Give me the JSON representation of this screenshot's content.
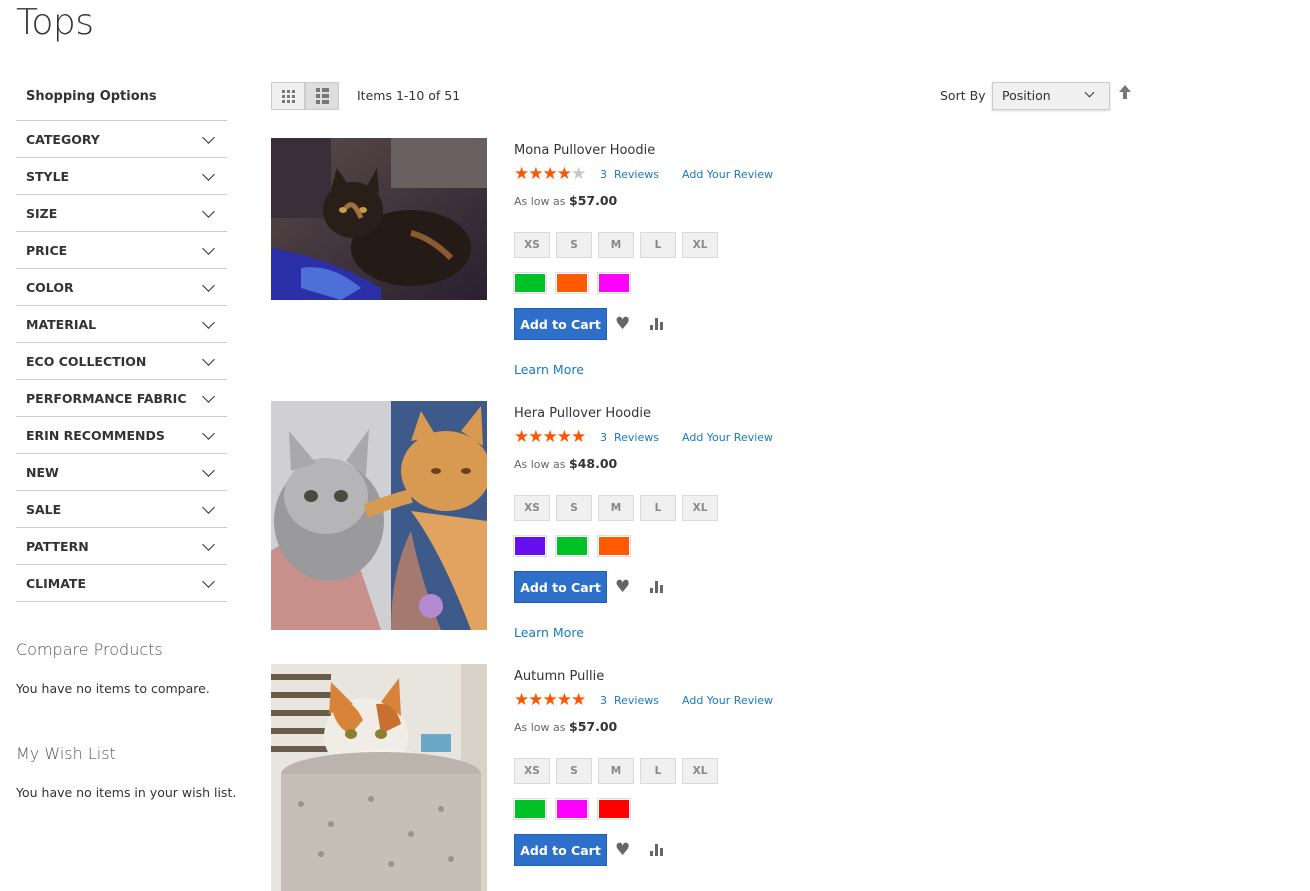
{
  "page": {
    "title": "Tops"
  },
  "sidebar": {
    "title": "Shopping Options",
    "filters": [
      "CATEGORY",
      "STYLE",
      "SIZE",
      "PRICE",
      "COLOR",
      "MATERIAL",
      "ECO COLLECTION",
      "PERFORMANCE FABRIC",
      "ERIN RECOMMENDS",
      "NEW",
      "SALE",
      "PATTERN",
      "CLIMATE"
    ],
    "compare": {
      "title": "Compare Products",
      "empty": "You have no items to compare."
    },
    "wishlist": {
      "title": "My Wish List",
      "empty": "You have no items in your wish list."
    }
  },
  "toolbar": {
    "view_modes": [
      "grid-icon",
      "list-icon"
    ],
    "active_mode": "list",
    "amount": "Items 1-10 of 51",
    "sort_label": "Sort By",
    "sort_value": "Position",
    "sort_direction_icon": "arrow-up-icon"
  },
  "colors": {
    "link": "#1979c3",
    "button": "#2e6fca",
    "star": "#ff5501",
    "star_off": "#c6c6c6"
  },
  "products": [
    {
      "name": "Mona Pullover Hoodie",
      "rating_stars": 4,
      "reviews_count": "3",
      "reviews_label": "Reviews",
      "add_review": "Add Your Review",
      "price_prefix": "As low as",
      "price": "$57.00",
      "sizes": [
        "XS",
        "S",
        "M",
        "L",
        "XL"
      ],
      "swatches": [
        "#00c226",
        "#ff5a00",
        "#ff00ff"
      ],
      "cart_label": "Add to Cart",
      "learn_more": "Learn More"
    },
    {
      "name": "Hera Pullover Hoodie",
      "rating_stars": 5,
      "reviews_count": "3",
      "reviews_label": "Reviews",
      "add_review": "Add Your Review",
      "price_prefix": "As low as",
      "price": "$48.00",
      "sizes": [
        "XS",
        "S",
        "M",
        "L",
        "XL"
      ],
      "swatches": [
        "#6610f2",
        "#00c226",
        "#ff5a00"
      ],
      "cart_label": "Add to Cart",
      "learn_more": "Learn More"
    },
    {
      "name": "Autumn Pullie",
      "rating_stars": 5,
      "reviews_count": "3",
      "reviews_label": "Reviews",
      "add_review": "Add Your Review",
      "price_prefix": "As low as",
      "price": "$57.00",
      "sizes": [
        "XS",
        "S",
        "M",
        "L",
        "XL"
      ],
      "swatches": [
        "#00c226",
        "#ff00ff",
        "#ff0000"
      ],
      "cart_label": "Add to Cart",
      "learn_more": ""
    }
  ]
}
